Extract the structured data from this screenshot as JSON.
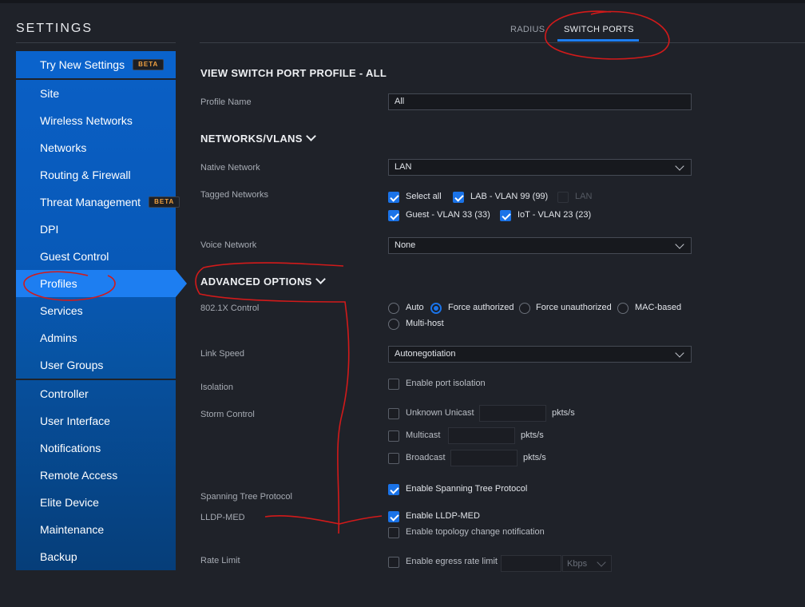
{
  "app_title": "SETTINGS",
  "sidebar": {
    "try_new": {
      "label": "Try New Settings",
      "badge": "BETA"
    },
    "items": [
      {
        "label": "Site"
      },
      {
        "label": "Wireless Networks"
      },
      {
        "label": "Networks"
      },
      {
        "label": "Routing & Firewall"
      },
      {
        "label": "Threat Management",
        "badge": "BETA"
      },
      {
        "label": "DPI"
      },
      {
        "label": "Guest Control"
      },
      {
        "label": "Profiles",
        "active": true
      },
      {
        "label": "Services"
      },
      {
        "label": "Admins"
      },
      {
        "label": "User Groups"
      }
    ],
    "controller_items": [
      {
        "label": "Controller"
      },
      {
        "label": "User Interface"
      },
      {
        "label": "Notifications"
      },
      {
        "label": "Remote Access"
      },
      {
        "label": "Elite Device"
      },
      {
        "label": "Maintenance"
      },
      {
        "label": "Backup"
      }
    ]
  },
  "tabs": [
    {
      "label": "RADIUS"
    },
    {
      "label": "SWITCH PORTS",
      "active": true
    }
  ],
  "profile": {
    "title": "VIEW SWITCH PORT PROFILE - ALL",
    "name_label": "Profile Name",
    "name_value": "All"
  },
  "networks": {
    "title": "NETWORKS/VLANS",
    "native_label": "Native Network",
    "native_value": "LAN",
    "tagged_label": "Tagged Networks",
    "tagged": [
      {
        "label": "Select all",
        "checked": true
      },
      {
        "label": "LAB - VLAN 99 (99)",
        "checked": true
      },
      {
        "label": "LAN",
        "checked": false,
        "disabled": true
      },
      {
        "label": "Guest - VLAN 33 (33)",
        "checked": true
      },
      {
        "label": "IoT - VLAN 23 (23)",
        "checked": true
      }
    ],
    "voice_label": "Voice Network",
    "voice_value": "None"
  },
  "advanced": {
    "title": "ADVANCED OPTIONS",
    "dot1x_label": "802.1X Control",
    "dot1x_options": [
      {
        "label": "Auto",
        "checked": false
      },
      {
        "label": "Force authorized",
        "checked": true
      },
      {
        "label": "Force unauthorized",
        "checked": false
      },
      {
        "label": "MAC-based",
        "checked": false
      },
      {
        "label": "Multi-host",
        "checked": false
      }
    ],
    "link_speed_label": "Link Speed",
    "link_speed_value": "Autonegotiation",
    "isolation_label": "Isolation",
    "isolation_option": "Enable port isolation",
    "storm_label": "Storm Control",
    "storm_options": [
      {
        "label": "Unknown Unicast",
        "unit": "pkts/s"
      },
      {
        "label": "Multicast",
        "unit": "pkts/s"
      },
      {
        "label": "Broadcast",
        "unit": "pkts/s"
      }
    ],
    "stp_label": "Spanning Tree Protocol",
    "stp_option": "Enable Spanning Tree Protocol",
    "lldp_label": "LLDP-MED",
    "lldp_option": "Enable LLDP-MED",
    "topology_option": "Enable topology change notification",
    "rate_label": "Rate Limit",
    "rate_option": "Enable egress rate limit",
    "rate_unit": "Kbps"
  },
  "colors": {
    "background": "#1f2229",
    "sidebar_blue": "#0a5fc4",
    "accent": "#1d7ef1",
    "annotation": "#d21a1a"
  }
}
